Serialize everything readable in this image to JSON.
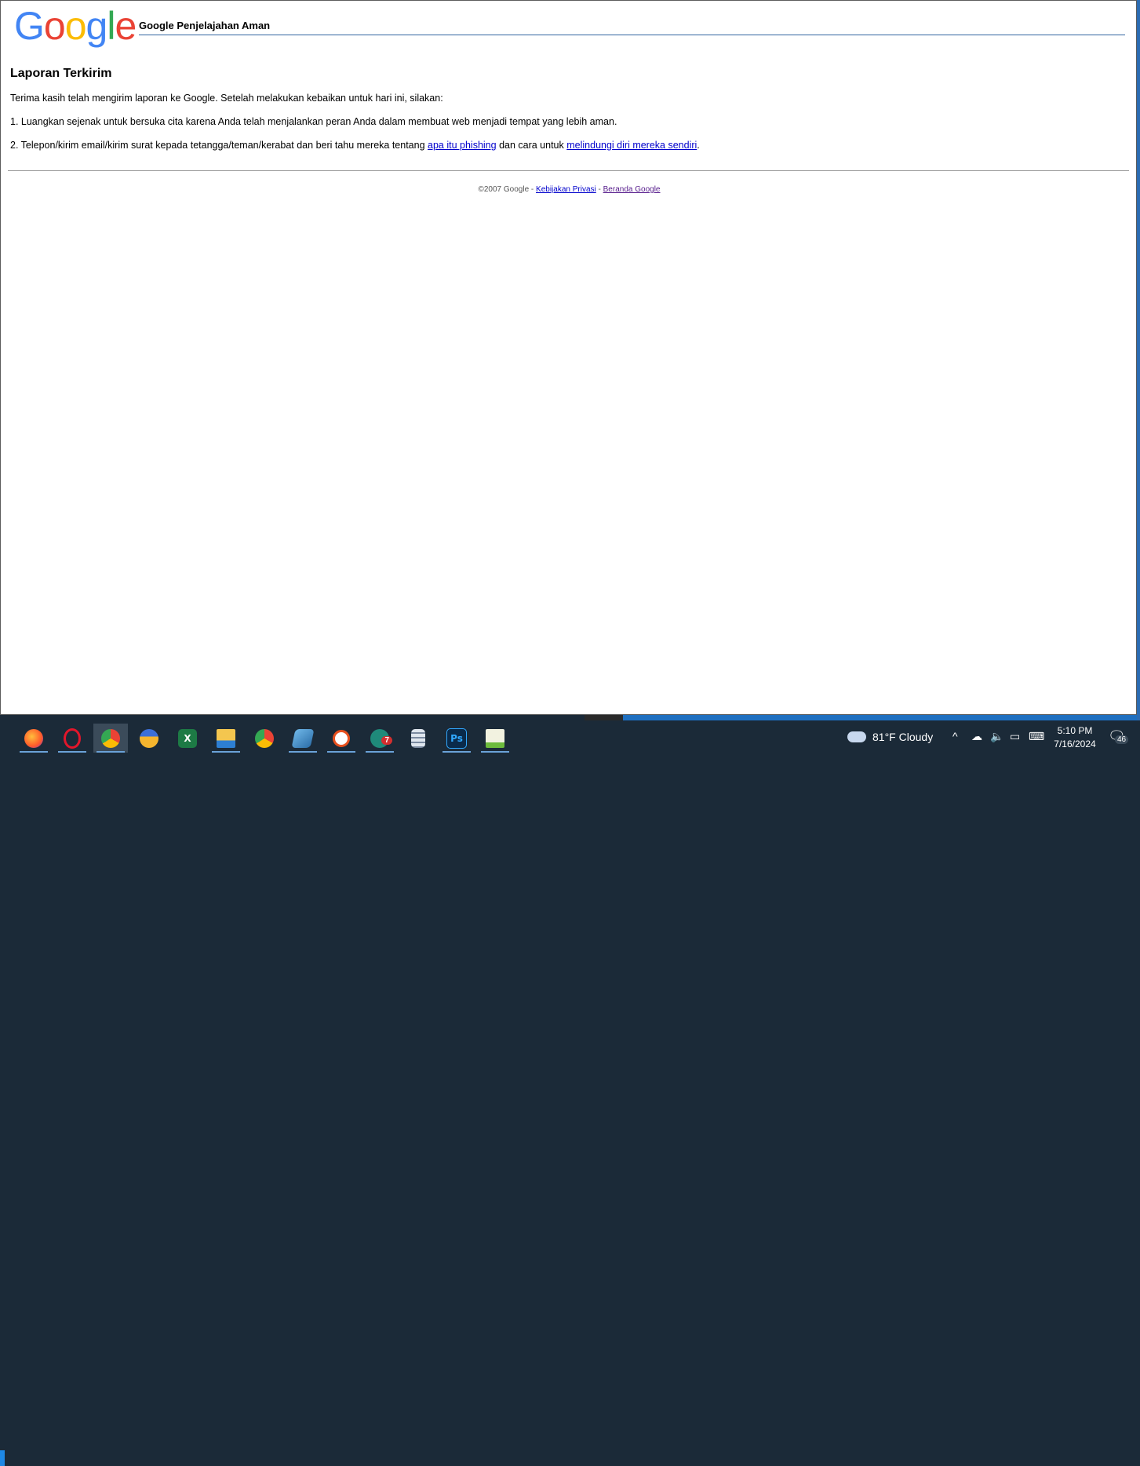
{
  "header": {
    "logo_letters": [
      "G",
      "o",
      "o",
      "g",
      "l",
      "e"
    ],
    "title": "Google Penjelajahan Aman"
  },
  "main": {
    "heading": "Laporan Terkirim",
    "intro": "Terima kasih telah mengirim laporan ke Google. Setelah melakukan kebaikan untuk hari ini, silakan:",
    "step1": "1. Luangkan sejenak untuk bersuka cita karena Anda telah menjalankan peran Anda dalam membuat web menjadi tempat yang lebih aman.",
    "step2_prefix": "2. Telepon/kirim email/kirim surat kepada tetangga/teman/kerabat dan beri tahu mereka tentang ",
    "step2_link1": "apa itu phishing",
    "step2_middle": " dan cara untuk ",
    "step2_link2": "melindungi diri mereka sendiri",
    "step2_suffix": "."
  },
  "footer": {
    "copyright": "©2007 Google - ",
    "privacy_link": "Kebijakan Privasi",
    "separator": " - ",
    "home_link": "Beranda Google"
  },
  "taskbar": {
    "apps": [
      {
        "name": "firefox",
        "icon": "firefox-icon"
      },
      {
        "name": "opera",
        "icon": "opera-icon"
      },
      {
        "name": "chrome-c",
        "icon": "chrome-icon"
      },
      {
        "name": "medal",
        "icon": "medal-icon"
      },
      {
        "name": "excel",
        "icon": "excel-icon",
        "label": "X"
      },
      {
        "name": "file-explorer",
        "icon": "folder-icon"
      },
      {
        "name": "chrome-2",
        "icon": "chrome-icon"
      },
      {
        "name": "notepad-blue",
        "icon": "notepad-icon"
      },
      {
        "name": "chat",
        "icon": "chat-icon"
      },
      {
        "name": "support",
        "icon": "support-icon",
        "badge": "7"
      },
      {
        "name": "calculator",
        "icon": "calculator-icon"
      },
      {
        "name": "photoshop",
        "icon": "photoshop-icon",
        "label": "Ps"
      },
      {
        "name": "notepad-plus",
        "icon": "notepad-plus-icon"
      }
    ],
    "weather": "81°F  Cloudy",
    "time": "5:10 PM",
    "date": "7/16/2024",
    "notification_count": "46"
  }
}
